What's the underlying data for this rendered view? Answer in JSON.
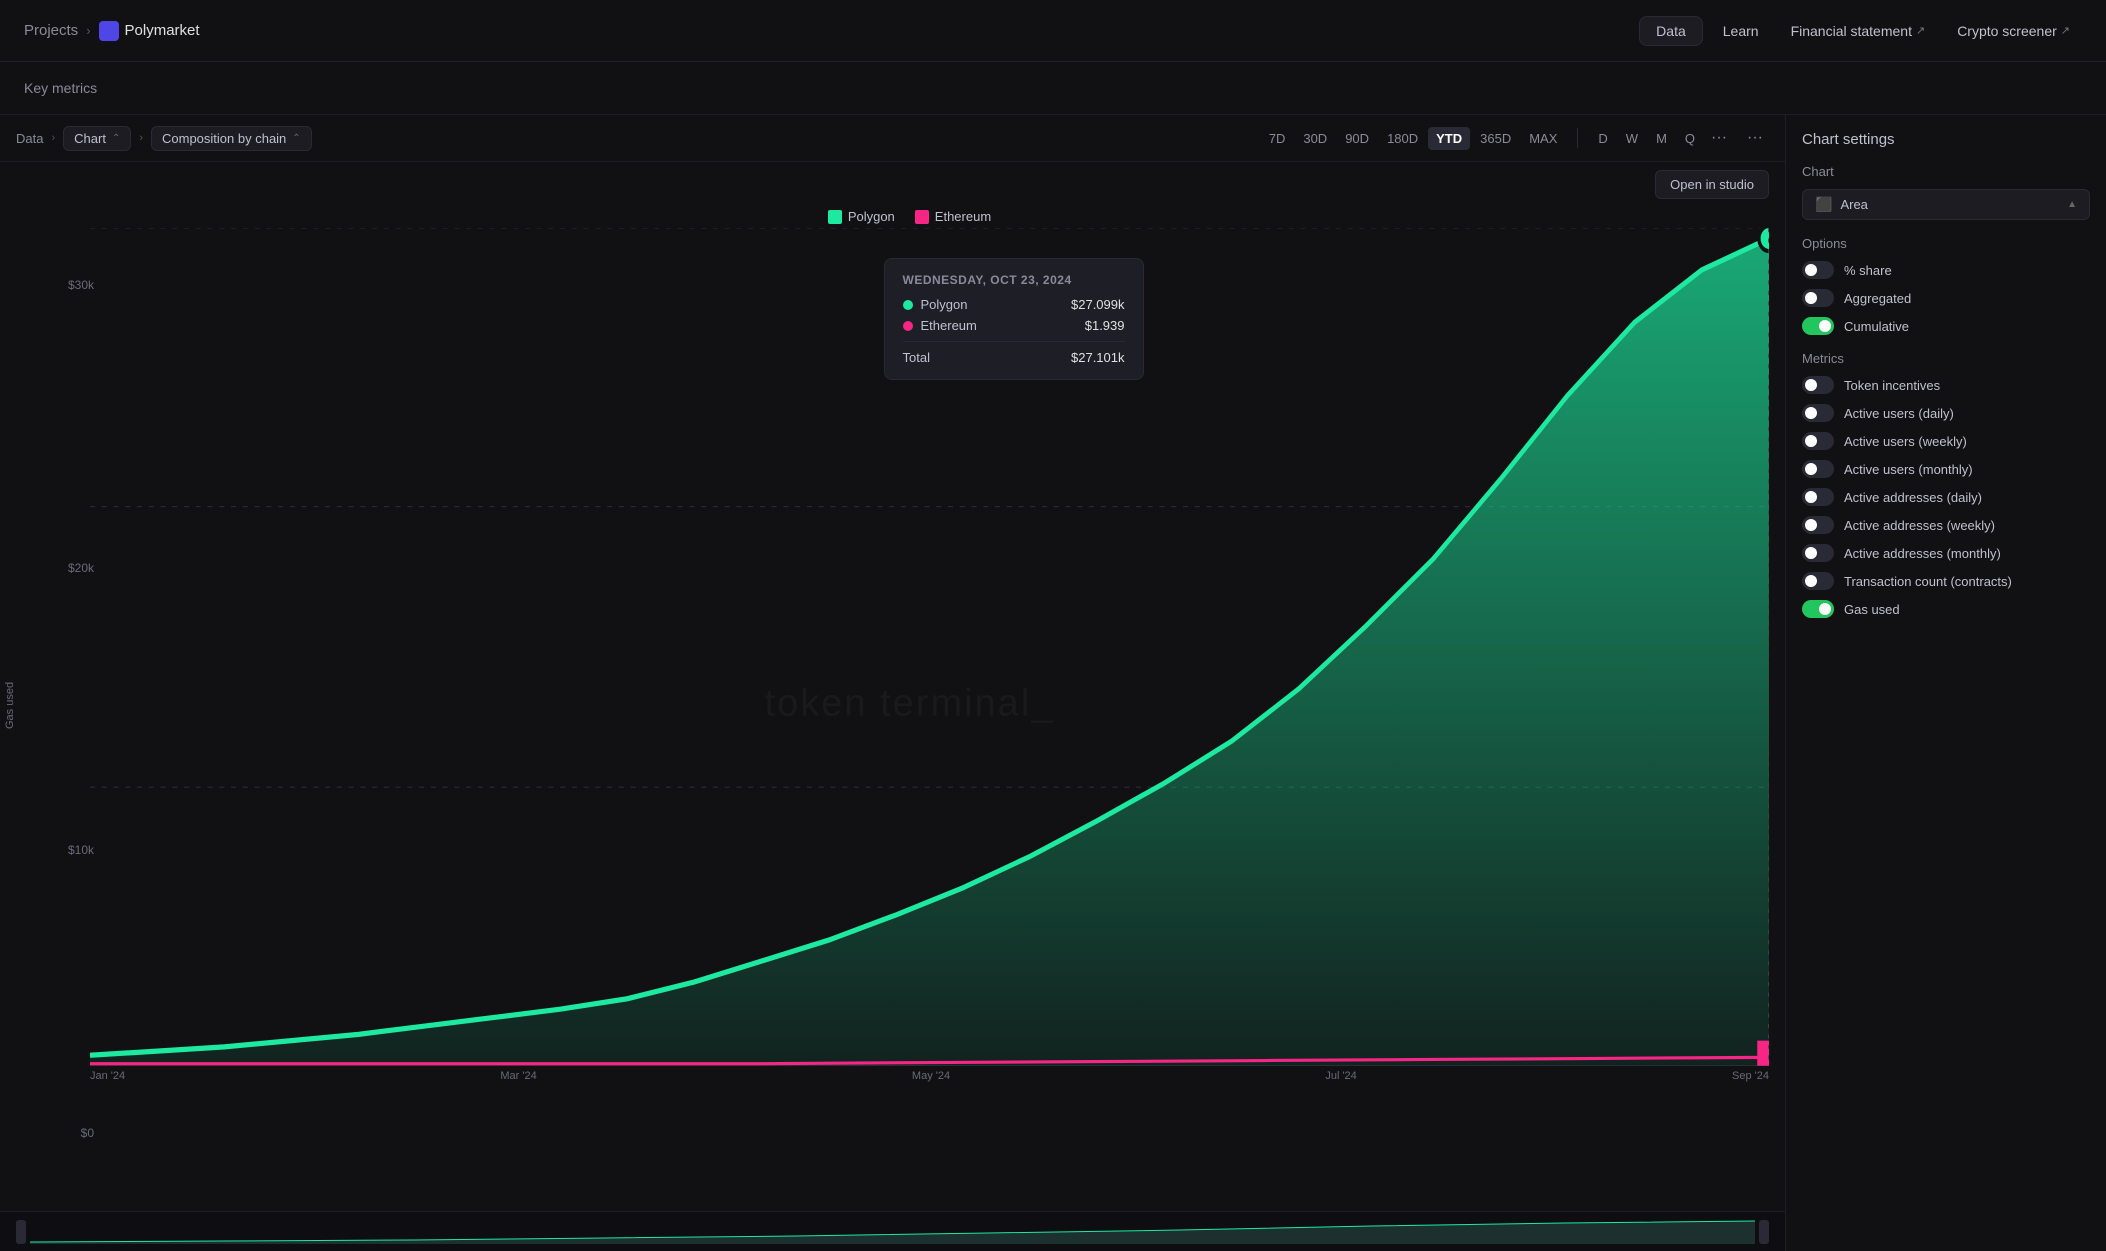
{
  "topnav": {
    "projects_label": "Projects",
    "project_name": "Polymarket",
    "nav_data": "Data",
    "nav_learn": "Learn",
    "nav_financial": "Financial statement",
    "nav_crypto": "Crypto screener"
  },
  "key_metrics": {
    "label": "Key metrics"
  },
  "toolbar": {
    "data_label": "Data",
    "chart_label": "Chart",
    "composition_label": "Composition by chain",
    "time_buttons": [
      "7D",
      "30D",
      "90D",
      "180D",
      "YTD",
      "365D",
      "MAX"
    ],
    "active_time": "YTD",
    "freq_buttons": [
      "D",
      "W",
      "M",
      "Q"
    ],
    "open_studio": "Open in studio"
  },
  "legend": [
    {
      "label": "Polygon",
      "color": "#1de9a0"
    },
    {
      "label": "Ethereum",
      "color": "#f72585"
    }
  ],
  "y_axis": {
    "labels": [
      "$30k",
      "$20k",
      "$10k",
      "$0"
    ],
    "title": "Gas used"
  },
  "x_axis": {
    "labels": [
      "Jan '24",
      "Mar '24",
      "May '24",
      "Jul '24",
      "Sep '24"
    ]
  },
  "tooltip": {
    "date": "WEDNESDAY, OCT 23, 2024",
    "rows": [
      {
        "label": "Polygon",
        "value": "$27.099k",
        "color": "#1de9a0"
      },
      {
        "label": "Ethereum",
        "value": "$1.939",
        "color": "#f72585"
      }
    ],
    "total_label": "Total",
    "total_value": "$27.101k"
  },
  "right_panel": {
    "title": "Chart settings",
    "chart_section": "Chart",
    "chart_type": "Area",
    "options_section": "Options",
    "toggles_options": [
      {
        "label": "% share",
        "on": false
      },
      {
        "label": "Aggregated",
        "on": false
      },
      {
        "label": "Cumulative",
        "on": true
      }
    ],
    "metrics_section": "Metrics",
    "metrics": [
      {
        "label": "Token incentives",
        "on": false
      },
      {
        "label": "Active users (daily)",
        "on": false
      },
      {
        "label": "Active users (weekly)",
        "on": false
      },
      {
        "label": "Active users (monthly)",
        "on": false
      },
      {
        "label": "Active addresses (daily)",
        "on": false
      },
      {
        "label": "Active addresses (weekly)",
        "on": false
      },
      {
        "label": "Active addresses (monthly)",
        "on": false
      },
      {
        "label": "Transaction count (contracts)",
        "on": false
      },
      {
        "label": "Gas used",
        "on": true
      }
    ]
  },
  "watermark": "token terminal_"
}
